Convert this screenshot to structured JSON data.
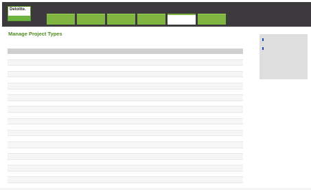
{
  "header": {
    "logo_top": "Deloitte.",
    "logo_bottom": "",
    "user_links": "",
    "tabs": [
      {
        "label": "",
        "active": false
      },
      {
        "label": "",
        "active": false
      },
      {
        "label": "",
        "active": false
      },
      {
        "label": "",
        "active": false
      },
      {
        "label": "",
        "active": true
      },
      {
        "label": "",
        "active": false
      }
    ]
  },
  "page": {
    "title": "Manage Project Types",
    "add_link": ""
  },
  "table": {
    "columns": [
      "",
      "",
      ""
    ],
    "rows": [
      {
        "name": "",
        "code": "",
        "actions": ""
      },
      {
        "name": "",
        "code": "",
        "actions": ""
      },
      {
        "name": "",
        "code": "",
        "actions": ""
      },
      {
        "name": "",
        "code": "",
        "actions": ""
      },
      {
        "name": "",
        "code": "",
        "actions": ""
      },
      {
        "name": "",
        "code": "",
        "actions": ""
      },
      {
        "name": "",
        "code": "",
        "actions": ""
      },
      {
        "name": "",
        "code": "",
        "actions": ""
      },
      {
        "name": "",
        "code": "",
        "actions": ""
      },
      {
        "name": "",
        "code": "",
        "actions": ""
      },
      {
        "name": "",
        "code": "",
        "actions": ""
      },
      {
        "name": "",
        "code": "",
        "actions": ""
      },
      {
        "name": "",
        "code": "",
        "actions": ""
      },
      {
        "name": "",
        "code": "",
        "actions": ""
      },
      {
        "name": "",
        "code": "",
        "actions": ""
      },
      {
        "name": "",
        "code": "",
        "actions": ""
      },
      {
        "name": "",
        "code": "",
        "actions": ""
      },
      {
        "name": "",
        "code": "",
        "actions": ""
      },
      {
        "name": "",
        "code": "",
        "actions": ""
      },
      {
        "name": "",
        "code": "",
        "actions": ""
      },
      {
        "name": "",
        "code": "",
        "actions": ""
      },
      {
        "name": "",
        "code": "",
        "actions": ""
      }
    ],
    "footnote": ""
  },
  "sidebar": {
    "section1_title": "",
    "section1_items": [
      "",
      ""
    ],
    "section2_title": "",
    "section2_items": [
      "",
      ""
    ]
  },
  "colors": {
    "header_bg": "#3c3a3c",
    "tab_green": "#7fb540",
    "title_green": "#4d8a1e",
    "link_blue": "#1a4aa8"
  }
}
